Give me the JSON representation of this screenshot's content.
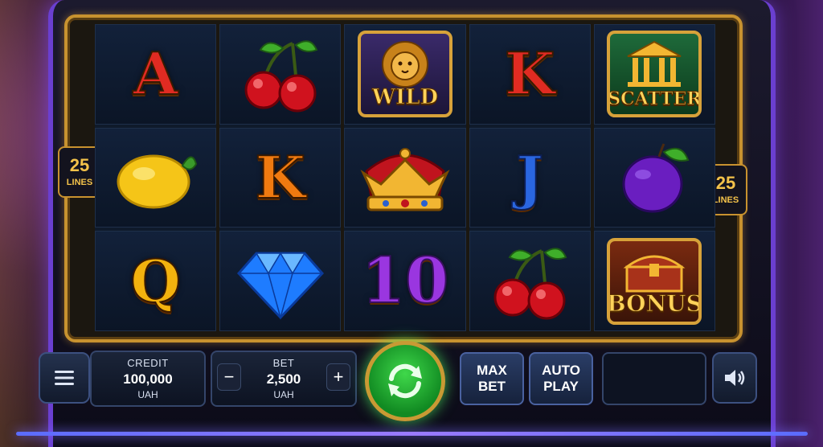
{
  "lines": {
    "count": "25",
    "label": "LINES"
  },
  "reels": [
    [
      {
        "type": "letter",
        "symbol": "A",
        "color": "red"
      },
      {
        "type": "icon",
        "symbol": "lemon"
      },
      {
        "type": "letter",
        "symbol": "Q",
        "color": "gold"
      }
    ],
    [
      {
        "type": "icon",
        "symbol": "cherries"
      },
      {
        "type": "letter",
        "symbol": "K",
        "color": "orange"
      },
      {
        "type": "icon",
        "symbol": "diamond"
      }
    ],
    [
      {
        "type": "badge",
        "symbol": "wild",
        "label": "WILD",
        "icon": "lion-icon"
      },
      {
        "type": "icon",
        "symbol": "crown"
      },
      {
        "type": "letter",
        "symbol": "10",
        "color": "purple"
      }
    ],
    [
      {
        "type": "letter",
        "symbol": "K",
        "color": "red"
      },
      {
        "type": "letter",
        "symbol": "J",
        "color": "blue"
      },
      {
        "type": "icon",
        "symbol": "cherries"
      }
    ],
    [
      {
        "type": "badge",
        "symbol": "scatter",
        "label": "SCATTER",
        "icon": "temple-icon"
      },
      {
        "type": "icon",
        "symbol": "plum"
      },
      {
        "type": "badge",
        "symbol": "bonus",
        "label": "BONUS",
        "icon": "treasure-chest-icon"
      }
    ]
  ],
  "controls": {
    "menu_icon": "menu-icon",
    "credit": {
      "label": "CREDIT",
      "value": "100,000",
      "currency": "UAH"
    },
    "bet": {
      "label": "BET",
      "value": "2,500",
      "currency": "UAH",
      "decrease": "−",
      "increase": "+"
    },
    "spin_icon": "spin-arrows-icon",
    "max_bet": "MAX\nBET",
    "auto_play": "AUTO\nPLAY",
    "sound_icon": "speaker-icon"
  },
  "colors": {
    "frame_gold": "#c8922f",
    "spin_green": "#2bbf3a",
    "accent_purple": "#6a3fd0"
  }
}
